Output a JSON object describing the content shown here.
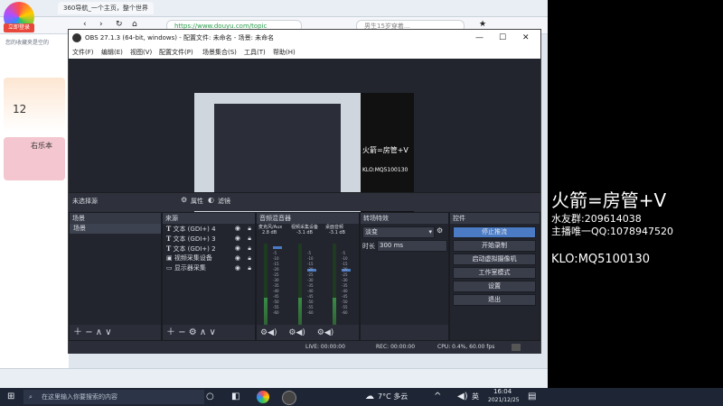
{
  "browser": {
    "tab_title": "360导航_一个主页，整个世界",
    "url": "https://www.douyu.com/topic",
    "news_text": "男生15岁穿着...",
    "login_label": "立即登录",
    "favorites_text": "您的收藏夹是空的",
    "card1_number": "12",
    "card2_text": "右乐本"
  },
  "obs": {
    "title": "OBS 27.1.3 (64-bit, windows) - 配置文件: 未命名 - 场景: 未命名",
    "menu": [
      "文件(F)",
      "编辑(E)",
      "视图(V)",
      "配置文件(P)",
      "场景集合(S)",
      "工具(T)",
      "帮助(H)"
    ],
    "no_source_selected": "未选择源",
    "properties_label": "属性",
    "filters_label": "滤镜",
    "preview_overlay": {
      "line1": "火箭=房管+V",
      "line2": "KLO:MQ5100130"
    },
    "docks": {
      "scenes": {
        "title": "场景",
        "items": [
          "场景"
        ]
      },
      "sources": {
        "title": "来源",
        "items": [
          {
            "name": "文本 (GDI+) 4",
            "icon": "text-icon"
          },
          {
            "name": "文本 (GDI+) 3",
            "icon": "text-icon"
          },
          {
            "name": "文本 (GDI+) 2",
            "icon": "text-icon"
          },
          {
            "name": "视频采集设备",
            "icon": "camera-icon"
          },
          {
            "name": "显示器采集",
            "icon": "monitor-icon"
          }
        ]
      },
      "mixer": {
        "title": "音频混音器",
        "channels": [
          {
            "name": "麦克风/Aux",
            "db": "2.8 dB"
          },
          {
            "name": "视频采集设备",
            "db": "-3.1 dB"
          },
          {
            "name": "桌面音频",
            "db": "-3.1 dB"
          }
        ],
        "scale": [
          "0",
          "-5",
          "-10",
          "-15",
          "-20",
          "-25",
          "-30",
          "-35",
          "-40",
          "-45",
          "-50",
          "-55",
          "-60"
        ]
      },
      "transitions": {
        "title": "转场特效",
        "selected": "淡变",
        "duration_label": "时长",
        "duration_value": "300 ms"
      },
      "controls": {
        "title": "控件",
        "buttons": [
          "停止推流",
          "开始录制",
          "启动虚拟摄像机",
          "工作室模式",
          "设置",
          "退出"
        ]
      }
    },
    "status": {
      "live": "LIVE: 00:00:00",
      "rec": "REC: 00:00:00",
      "cpu": "CPU: 0.4%, 60.00 fps"
    }
  },
  "stream_overlay": {
    "title": "火箭=房管+V",
    "fan_group": "水友群:209614038",
    "host_qq": "主播唯一QQ:1078947520",
    "klo": "KLO:MQ5100130"
  },
  "taskbar": {
    "search_placeholder": "在这里输入你要搜索的内容",
    "weather": "7°C 多云",
    "language": "英",
    "time": "16:04",
    "date": "2021/12/25"
  },
  "colors": {
    "obs_bg": "#2b2e38",
    "accent": "#4a7bc4",
    "taskbar": "#1e2635"
  }
}
